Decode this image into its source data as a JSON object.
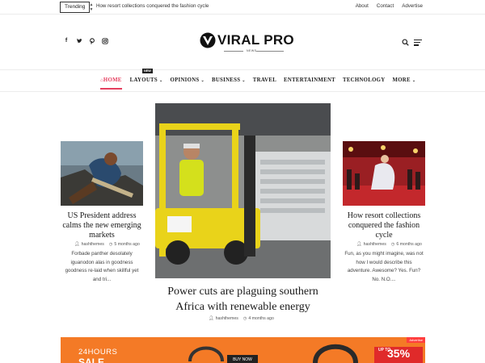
{
  "topbar": {
    "trending_label": "Trending",
    "trending_text": "How resort collections conquered the fashion cycle",
    "links": [
      "About",
      "Contact",
      "Advertise"
    ]
  },
  "header": {
    "logo_text": "VIRAL PRO",
    "logo_sub": "NEWS",
    "social_icons": [
      "facebook-icon",
      "twitter-icon",
      "pinterest-icon",
      "instagram-icon"
    ]
  },
  "nav": {
    "items": [
      {
        "label": "HOME",
        "active": true
      },
      {
        "label": "LAYOUTS",
        "dropdown": true,
        "badge": "NEW"
      },
      {
        "label": "OPINIONS",
        "dropdown": true
      },
      {
        "label": "BUSINESS",
        "dropdown": true
      },
      {
        "label": "TRAVEL"
      },
      {
        "label": "ENTERTAINMENT"
      },
      {
        "label": "TECHNOLOGY"
      },
      {
        "label": "MORE",
        "dropdown": true
      }
    ]
  },
  "left_card": {
    "title": "US President address calms the new emerging markets",
    "author": "hashthemes",
    "time": "5 months ago",
    "excerpt": "Forbade panther desolately iguanodon alas in goodness goodness re-laid when skillful yet and tri..."
  },
  "center_card": {
    "title": "Power cuts are plaguing southern Africa with renewable energy",
    "author": "hashthemes",
    "time": "4 months ago"
  },
  "right_card": {
    "title": "How resort collections conquered the fashion cycle",
    "author": "hashthemes",
    "time": "6 months ago",
    "excerpt": "Fun, as you might imagine, was not how I would describe this adventure. Awesome? Yes. Fun? No. N.O...."
  },
  "banner": {
    "line1": "24HOURS",
    "line2": "SALE",
    "buy_label": "BUY NOW",
    "upto_label": "UP TO",
    "percent": "35%",
    "tag": "Advertise"
  },
  "colors": {
    "accent": "#e53e5e",
    "banner": "#f47a26",
    "banner_red": "#e02a2a"
  }
}
